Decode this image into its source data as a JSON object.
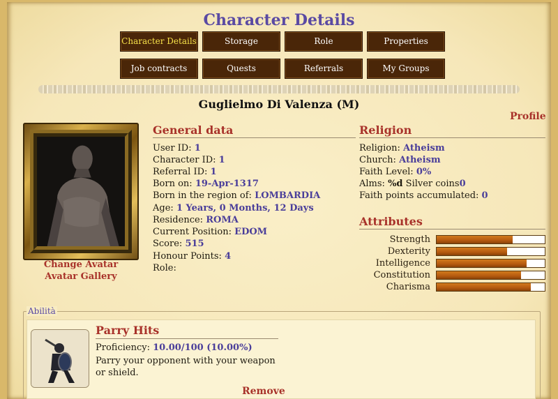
{
  "page_title": "Character Details",
  "nav": [
    {
      "label": "Character Details",
      "active": true
    },
    {
      "label": "Storage"
    },
    {
      "label": "Role"
    },
    {
      "label": "Properties"
    },
    {
      "label": "Job contracts"
    },
    {
      "label": "Quests"
    },
    {
      "label": "Referrals"
    },
    {
      "label": "My Groups"
    }
  ],
  "character": {
    "name": "Guglielmo Di Valenza (M)",
    "profile_link": "Profile",
    "change_avatar": "Change Avatar",
    "avatar_gallery": "Avatar Gallery"
  },
  "general": {
    "heading": "General data",
    "rows": [
      {
        "label": "User ID:",
        "value": "1"
      },
      {
        "label": "Character ID:",
        "value": "1"
      },
      {
        "label": "Referral ID:",
        "value": "1"
      },
      {
        "label": "Born on:",
        "value": "19-Apr-1317"
      },
      {
        "label": "Born in the region of:",
        "value": "LOMBARDIA"
      },
      {
        "label": "Age:",
        "value": "1 Years, 0 Months, 12 Days"
      },
      {
        "label": "Residence:",
        "value": "ROMA"
      },
      {
        "label": "Current Position:",
        "value": "EDOM"
      },
      {
        "label": "Score:",
        "value": "515"
      },
      {
        "label": "Honour Points:",
        "value": "4"
      },
      {
        "label": "Role:",
        "value": ""
      }
    ]
  },
  "religion": {
    "heading": "Religion",
    "rows": [
      {
        "label": "Religion:",
        "value": "Atheism",
        "suffix": ""
      },
      {
        "label": "Church:",
        "value": "Atheism",
        "suffix": ""
      },
      {
        "label": "Faith Level:",
        "value": "0%",
        "suffix": ""
      },
      {
        "label": "Alms:",
        "value": "%d",
        "suffix": " Silver coins",
        "value2": "0"
      },
      {
        "label": "Faith points accumulated:",
        "value": "0",
        "suffix": ""
      }
    ]
  },
  "attributes": {
    "heading": "Attributes",
    "items": [
      {
        "label": "Strength",
        "level": 0.7
      },
      {
        "label": "Dexterity",
        "level": 0.65
      },
      {
        "label": "Intelligence",
        "level": 0.83
      },
      {
        "label": "Constitution",
        "level": 0.78
      },
      {
        "label": "Charisma",
        "level": 0.87
      }
    ]
  },
  "abilities": {
    "legend": "Abilità",
    "skill": {
      "title": "Parry Hits",
      "proficiency_label": "Proficiency:",
      "proficiency_value": "10.00/100 (10.00%)",
      "description": "Parry your opponent with your weapon or shield.",
      "remove": "Remove"
    }
  }
}
